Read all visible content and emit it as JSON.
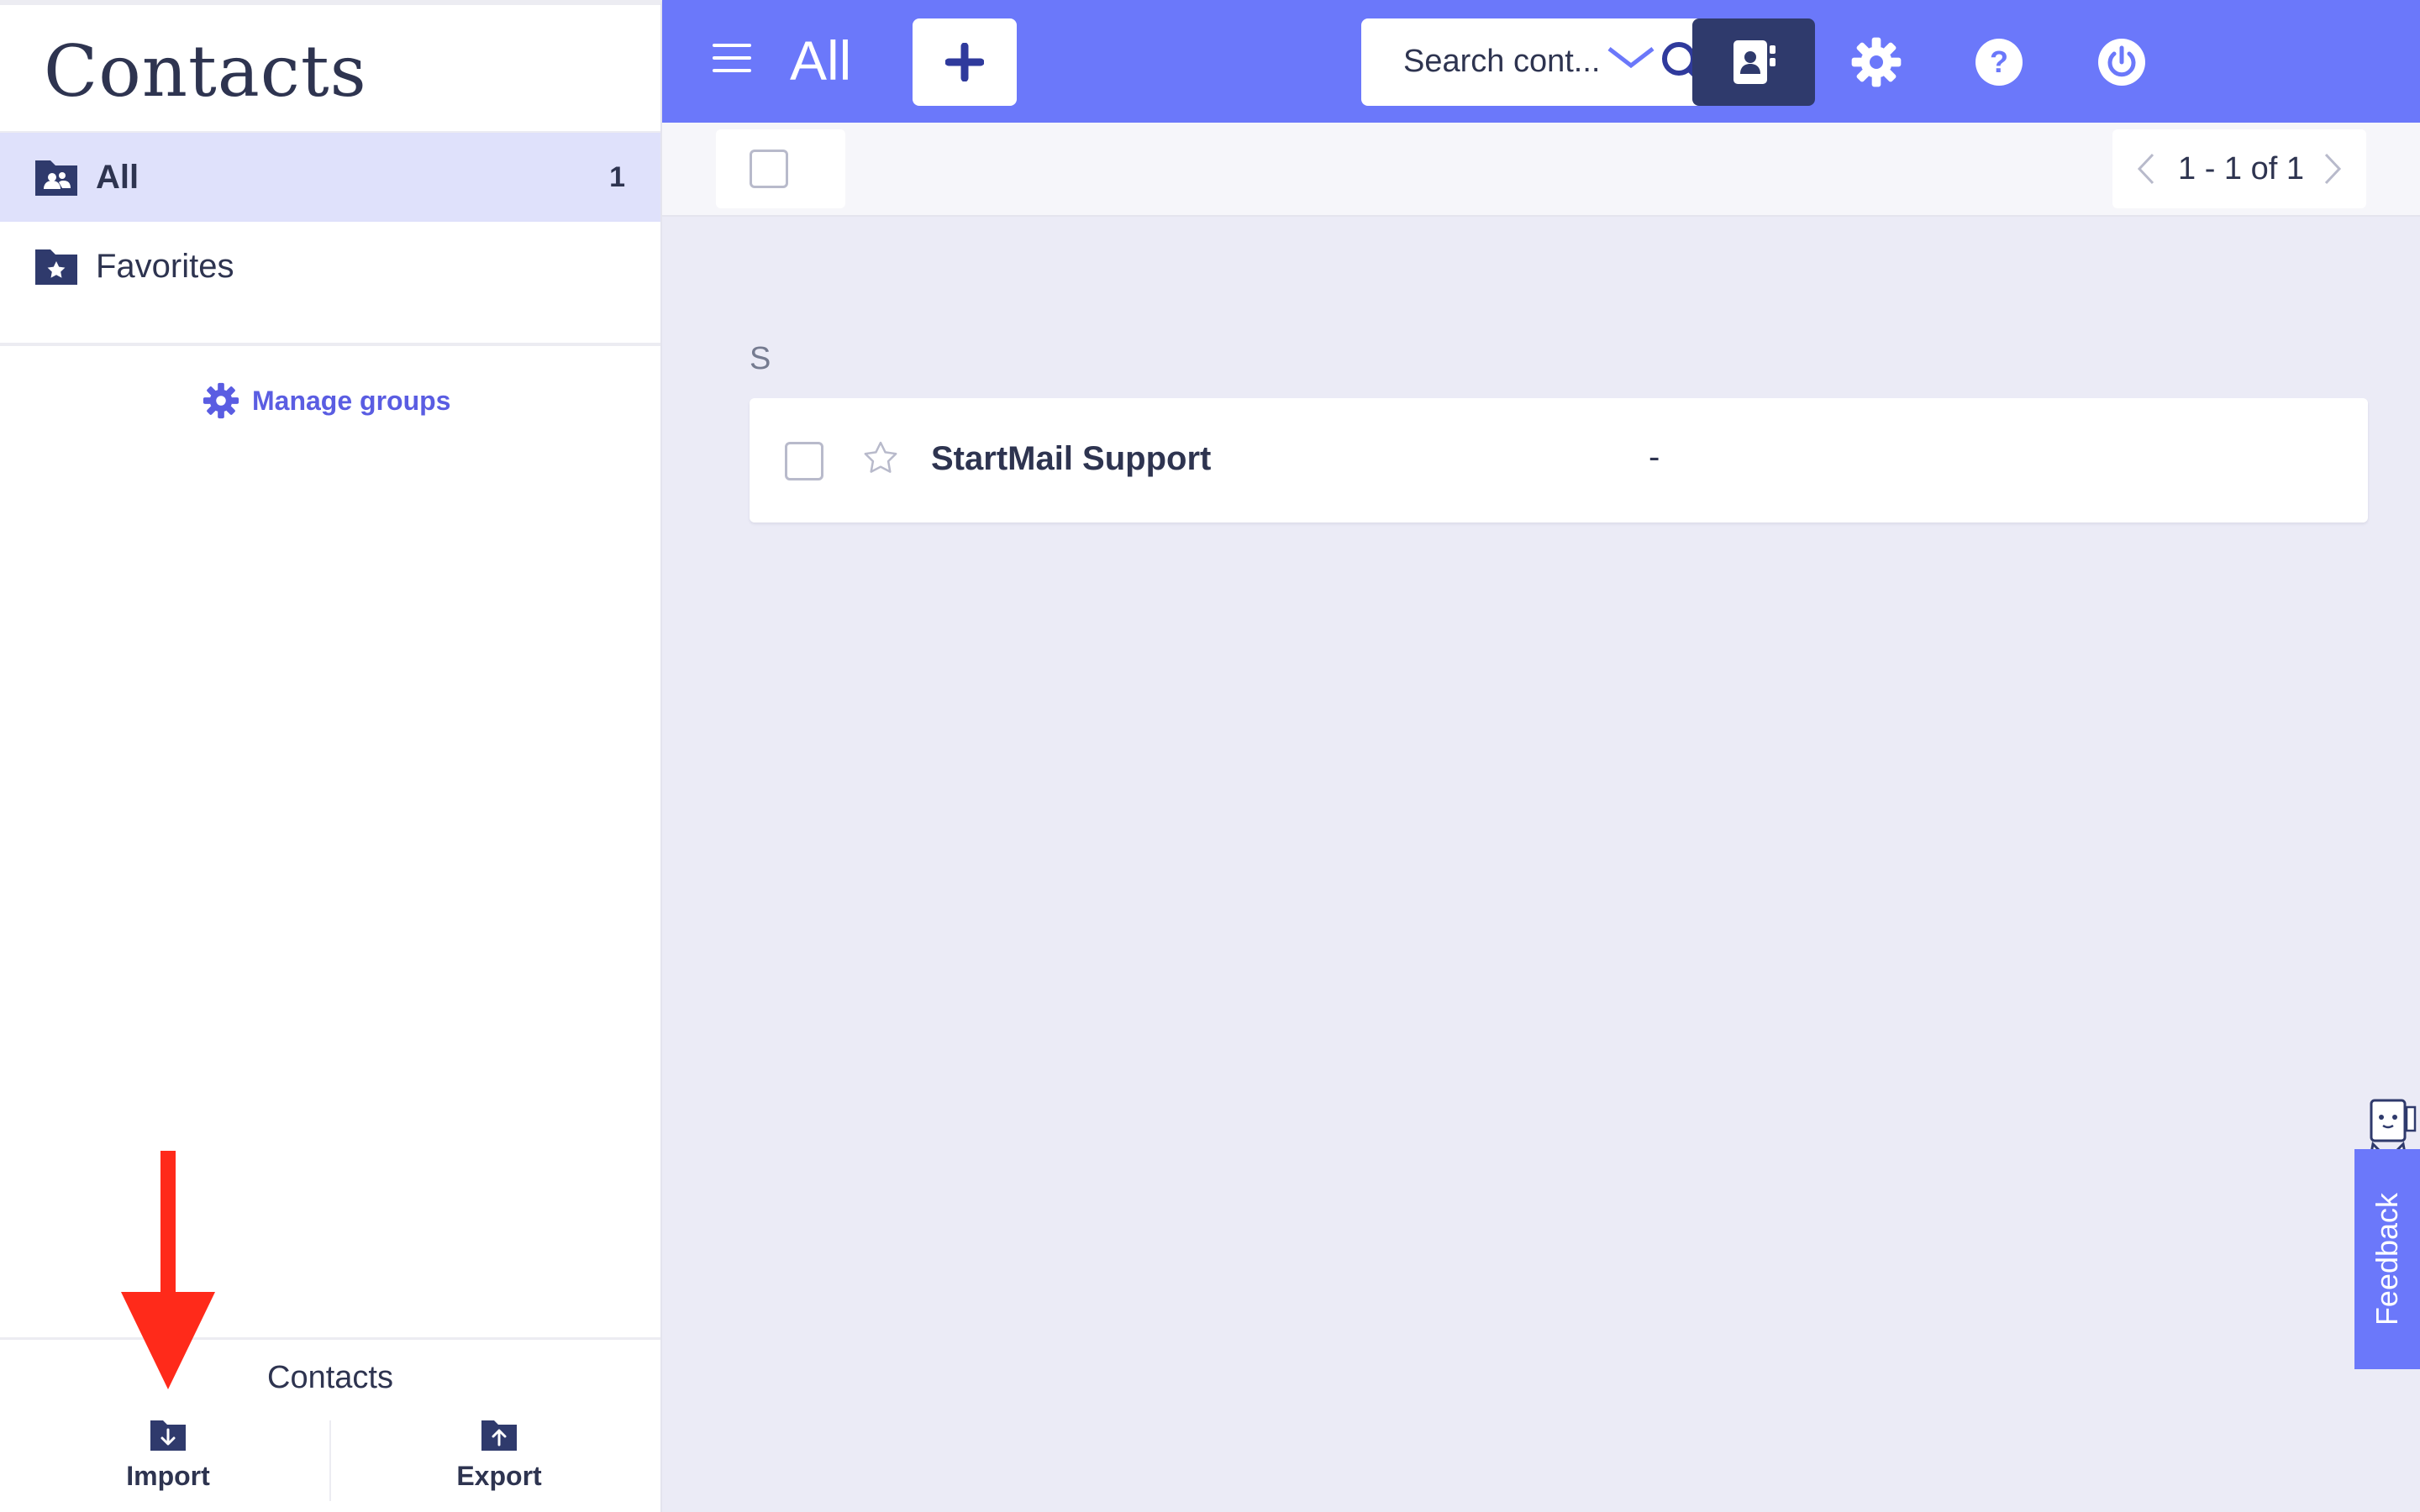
{
  "app": {
    "title": "Contacts"
  },
  "sidebar": {
    "items": [
      {
        "label": "All",
        "count": "1",
        "icon": "contacts-folder-icon",
        "active": true
      },
      {
        "label": "Favorites",
        "icon": "star-folder-icon",
        "active": false
      }
    ],
    "manage_groups": "Manage groups",
    "footer": {
      "title": "Contacts",
      "import_label": "Import",
      "export_label": "Export"
    }
  },
  "header": {
    "title": "All",
    "search_placeholder": "Search cont...",
    "icons": [
      "menu-icon",
      "plus-icon",
      "search-icon",
      "mail-icon",
      "contacts-card-icon",
      "gear-icon",
      "help-icon",
      "power-icon"
    ]
  },
  "toolbar": {
    "pager_text": "1 - 1 of 1"
  },
  "contacts": {
    "section_letter": "S",
    "rows": [
      {
        "name": "StartMail Support",
        "email": "-"
      }
    ]
  },
  "feedback": {
    "label": "Feedback"
  },
  "colors": {
    "accent": "#6b78fa",
    "active_nav_bg": "#dfe1fb",
    "dark_navy": "#2f3a6c",
    "link": "#5a5de2",
    "annotation_arrow": "#ff2a1a"
  }
}
